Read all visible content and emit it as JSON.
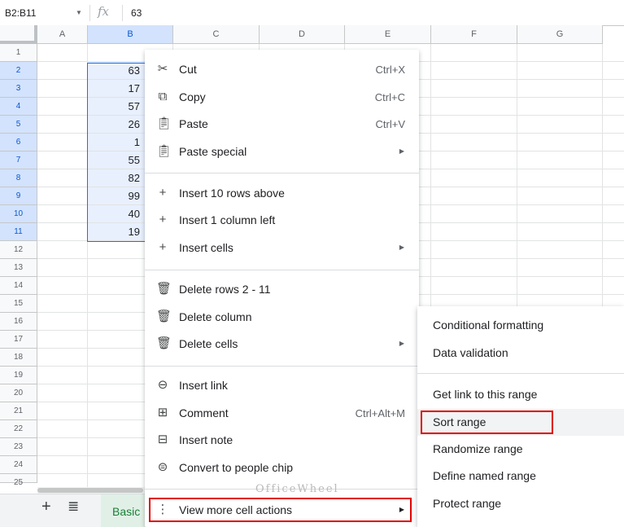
{
  "formula_bar": {
    "name_box": "B2:B11",
    "fx_label": "fx",
    "value": "63"
  },
  "columns": [
    "A",
    "B",
    "C",
    "D",
    "E",
    "F",
    "G"
  ],
  "rows": [
    "1",
    "2",
    "3",
    "4",
    "5",
    "6",
    "7",
    "8",
    "9",
    "10",
    "11",
    "12",
    "13",
    "14",
    "15",
    "16",
    "17",
    "18",
    "19",
    "20",
    "21",
    "22",
    "23",
    "24",
    "25"
  ],
  "cells_b": [
    "63",
    "17",
    "57",
    "26",
    "1",
    "55",
    "82",
    "99",
    "40",
    "19"
  ],
  "context_menu": {
    "cut": {
      "label": "Cut",
      "shortcut": "Ctrl+X"
    },
    "copy": {
      "label": "Copy",
      "shortcut": "Ctrl+C"
    },
    "paste": {
      "label": "Paste",
      "shortcut": "Ctrl+V"
    },
    "paste_special": {
      "label": "Paste special"
    },
    "insert_rows": {
      "label": "Insert 10 rows above"
    },
    "insert_column": {
      "label": "Insert 1 column left"
    },
    "insert_cells": {
      "label": "Insert cells"
    },
    "delete_rows": {
      "label": "Delete rows 2 - 11"
    },
    "delete_column": {
      "label": "Delete column"
    },
    "delete_cells": {
      "label": "Delete cells"
    },
    "insert_link": {
      "label": "Insert link"
    },
    "comment": {
      "label": "Comment",
      "shortcut": "Ctrl+Alt+M"
    },
    "insert_note": {
      "label": "Insert note"
    },
    "people_chip": {
      "label": "Convert to people chip"
    },
    "more_actions": {
      "label": "View more cell actions"
    }
  },
  "submenu": {
    "conditional_formatting": "Conditional formatting",
    "data_validation": "Data validation",
    "get_link": "Get link to this range",
    "sort_range": "Sort range",
    "randomize_range": "Randomize range",
    "define_named_range": "Define named range",
    "protect_range": "Protect range"
  },
  "sheet_tab": {
    "label": "Basic"
  },
  "watermark": "OfficeWheel",
  "icons": {
    "cut": "scissors-icon",
    "copy": "copy-icon",
    "paste": "clipboard-icon",
    "insert": "plus-icon",
    "delete": "trash-icon",
    "link": "link-icon",
    "comment": "comment-add-icon",
    "note": "note-icon",
    "chip": "person-chip-icon",
    "more": "more-vertical-icon",
    "submenu_arrow": "triangle-right-icon"
  },
  "colors": {
    "highlight": "#e00000",
    "selection": "#1a73e8",
    "sheet_tab_text": "#188038"
  }
}
